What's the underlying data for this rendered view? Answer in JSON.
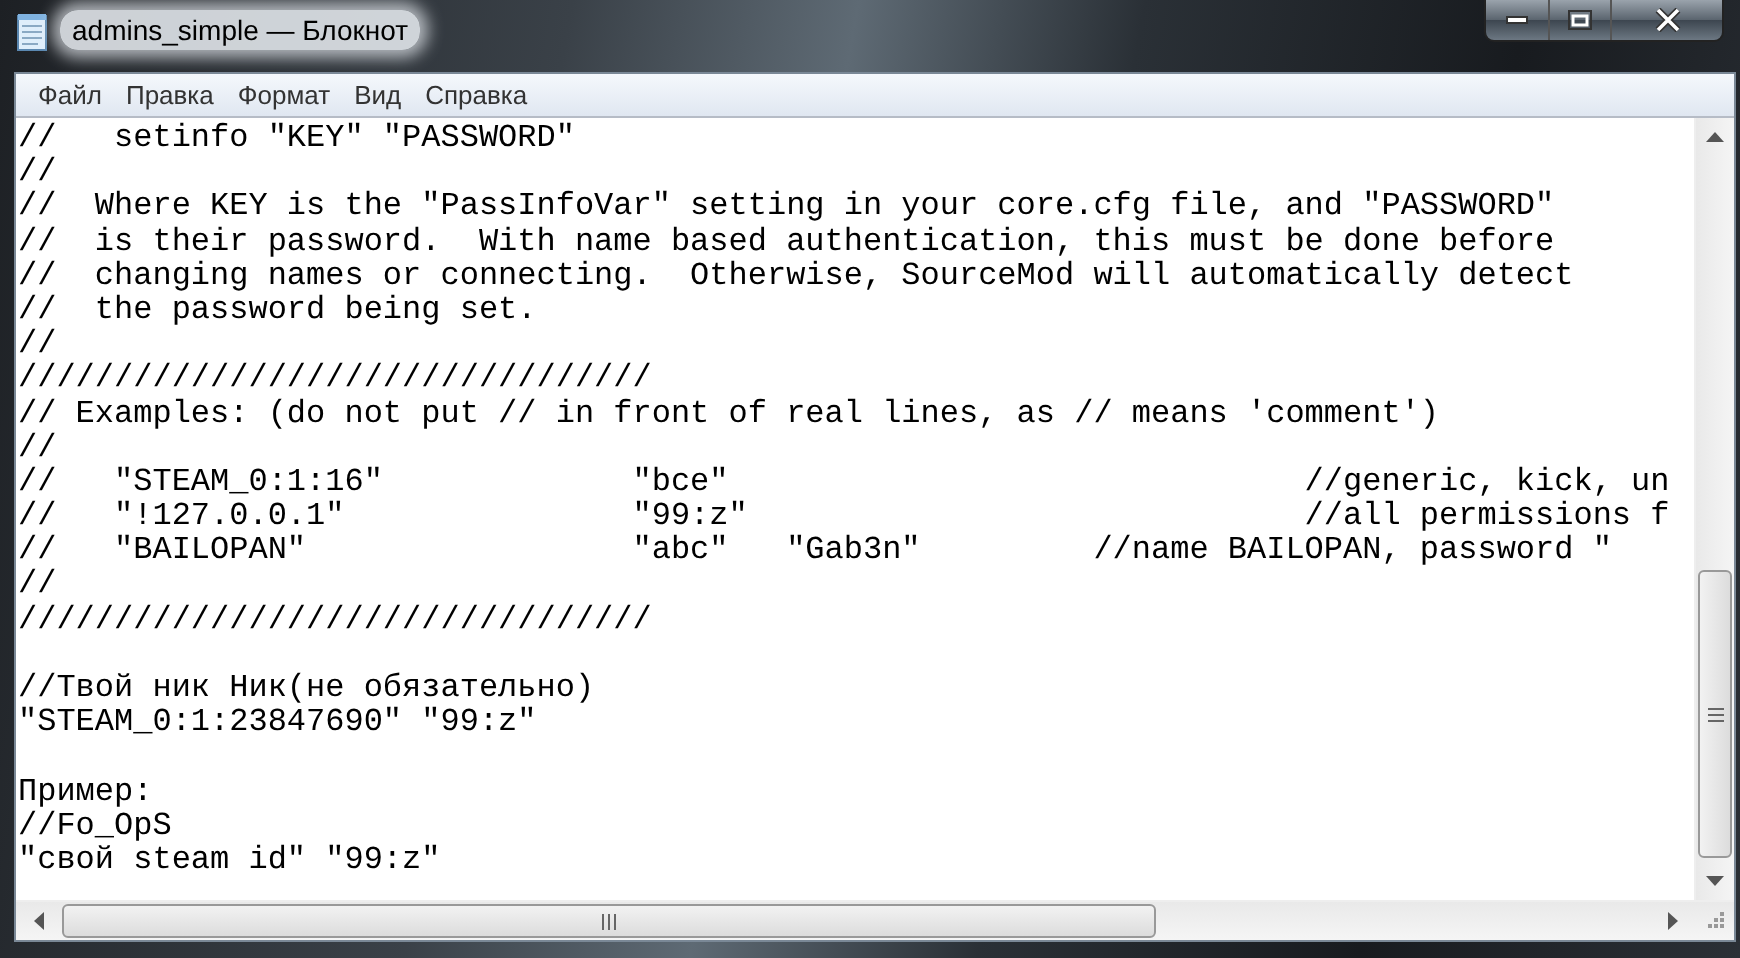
{
  "window": {
    "title": "admins_simple — Блокнот"
  },
  "menu": [
    "Файл",
    "Правка",
    "Формат",
    "Вид",
    "Справка"
  ],
  "lines": [
    {
      "kind": "text",
      "text": "//   setinfo \"KEY\" \"PASSWORD\""
    },
    {
      "kind": "text",
      "text": "//"
    },
    {
      "kind": "text",
      "text": "//  Where KEY is the \"PassInfoVar\" setting in your core.cfg file, and \"PASSWORD\""
    },
    {
      "kind": "text",
      "text": "//  is their password.  With name based authentication, this must be done before"
    },
    {
      "kind": "text",
      "text": "//  changing names or connecting.  Otherwise, SourceMod will automatically detect"
    },
    {
      "kind": "text",
      "text": "//  the password being set."
    },
    {
      "kind": "text",
      "text": "//"
    },
    {
      "kind": "text",
      "text": "/////////////////////////////////"
    },
    {
      "kind": "text",
      "text": "// Examples: (do not put // in front of real lines, as // means 'comment')"
    },
    {
      "kind": "text",
      "text": "//"
    },
    {
      "kind": "text",
      "text": "//   \"STEAM_0:1:16\"             \"bce\"                              //generic, kick, un"
    },
    {
      "kind": "text",
      "text": "//   \"!127.0.0.1\"               \"99:z\"                             //all permissions f"
    },
    {
      "kind": "text",
      "text": "//   \"BAILOPAN\"                 \"abc\"   \"Gab3n\"         //name BAILOPAN, password \""
    },
    {
      "kind": "text",
      "text": "//"
    },
    {
      "kind": "text",
      "text": "/////////////////////////////////"
    },
    {
      "kind": "blank"
    },
    {
      "kind": "text",
      "text": "//Твой ник Ник(не обязательно)"
    },
    {
      "kind": "text",
      "text": "\"STEAM_0:1:23847690\" \"99:z\""
    },
    {
      "kind": "blank"
    },
    {
      "kind": "text",
      "text": "Пример:"
    },
    {
      "kind": "text",
      "text": "//Fo_OpS"
    },
    {
      "kind": "text",
      "text": "\"свой steam id\" \"99:z\""
    }
  ]
}
